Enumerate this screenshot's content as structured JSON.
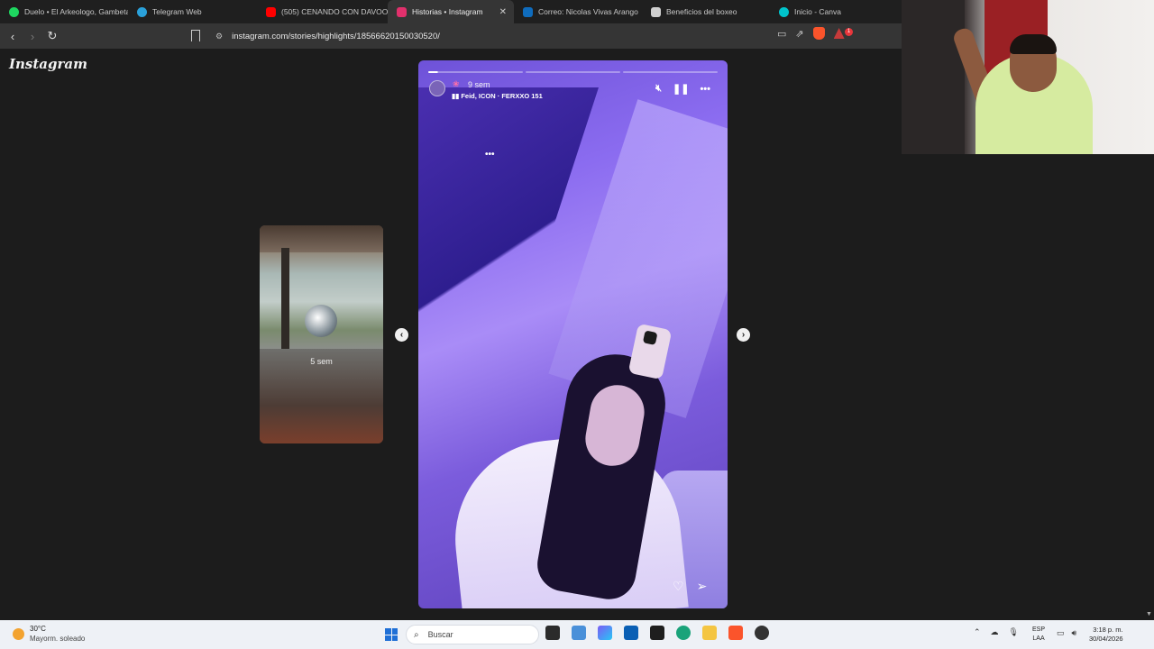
{
  "browser": {
    "tabs": [
      {
        "label": "Duelo • El Arkeologo, Gambeta",
        "icon": "spotify-icon",
        "color": "#1ed760",
        "active": false
      },
      {
        "label": "Telegram Web",
        "icon": "telegram-icon",
        "color": "#2aa1da",
        "active": false
      },
      {
        "label": "(505) CENANDO CON DAVOO",
        "icon": "youtube-icon",
        "color": "#ff0000",
        "active": false
      },
      {
        "label": "Historias • Instagram",
        "icon": "instagram-icon",
        "color": "#e1306c",
        "active": true
      },
      {
        "label": "Correo: Nicolas Vivas Arango",
        "icon": "outlook-icon",
        "color": "#0f6cbd",
        "active": false
      },
      {
        "label": "Beneficios del boxeo",
        "icon": "chatgpt-icon",
        "color": "#cfcfcf",
        "active": false
      },
      {
        "label": "Inicio - Canva",
        "icon": "canva-icon",
        "color": "#00c4cc",
        "active": false
      }
    ],
    "url": "instagram.com/stories/highlights/18566620150030520/",
    "notification_count": "1"
  },
  "page": {
    "logo": "Instagram",
    "prev_story_label": "5 sem",
    "story": {
      "time": "9 sem",
      "music": "Feid, ICON · FERXXO 151",
      "progress_segments": [
        "partial",
        "pending",
        "pending"
      ]
    }
  },
  "taskbar": {
    "weather_temp": "30°C",
    "weather_desc": "Mayorm. soleado",
    "search_placeholder": "Buscar",
    "lang_line1": "ESP",
    "lang_line2": "LAA",
    "time": "3:18 p. m.",
    "date": "30/04/2026"
  }
}
